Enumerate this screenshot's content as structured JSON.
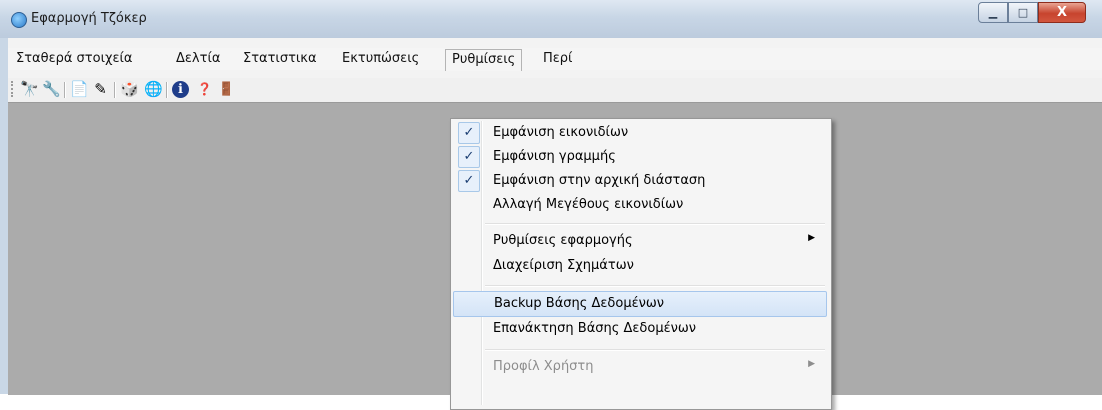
{
  "window": {
    "title": "Εφαρμογή Τζόκερ",
    "buttons": {
      "minimize": "▁",
      "maximize": "□",
      "close": "X"
    }
  },
  "menubar": {
    "items": [
      {
        "label": "Σταθερά στοιχεία"
      },
      {
        "label": "Δελτία"
      },
      {
        "label": "Στατιστικα"
      },
      {
        "label": "Εκτυπώσεις"
      },
      {
        "label": "Ρυθμίσεις",
        "open": true
      },
      {
        "label": "Περί"
      }
    ]
  },
  "toolbar": {
    "icons": [
      {
        "name": "open-icon",
        "glyph": "🔭"
      },
      {
        "name": "tool-icon",
        "glyph": "🔧"
      },
      {
        "name": "report-icon",
        "glyph": "📄"
      },
      {
        "name": "edit-icon",
        "glyph": "✎"
      },
      {
        "name": "stats-icon",
        "glyph": "🎲"
      },
      {
        "name": "globe-icon",
        "glyph": "🌐"
      },
      {
        "name": "info-icon",
        "glyph": "ℹ"
      },
      {
        "name": "help-icon",
        "glyph": "❓"
      },
      {
        "name": "exit-icon",
        "glyph": "🚪"
      }
    ]
  },
  "settings_menu": {
    "items": [
      {
        "label": "Εμφάνιση εικονιδίων",
        "checked": true,
        "check_glyph": "✓"
      },
      {
        "label": "Εμφάνιση γραμμής",
        "checked": true,
        "check_glyph": "✓"
      },
      {
        "label": "Εμφάνιση στην αρχική διάσταση",
        "checked": true,
        "check_glyph": "✓"
      },
      {
        "label": "Αλλαγή Μεγέθους εικονιδίων",
        "checked": false
      },
      {
        "label": "Ρυθμίσεις εφαρμογής",
        "submenu_glyph": "▶"
      },
      {
        "label": "Διαχείριση Σχημάτων"
      },
      {
        "label": "Backup Βάσης Δεδομένων",
        "highlighted": true
      },
      {
        "label": "Επανάκτηση Βάσης Δεδομένων"
      },
      {
        "label": "Προφίλ Χρήστη",
        "disabled": true,
        "submenu_glyph": "▶"
      }
    ]
  }
}
